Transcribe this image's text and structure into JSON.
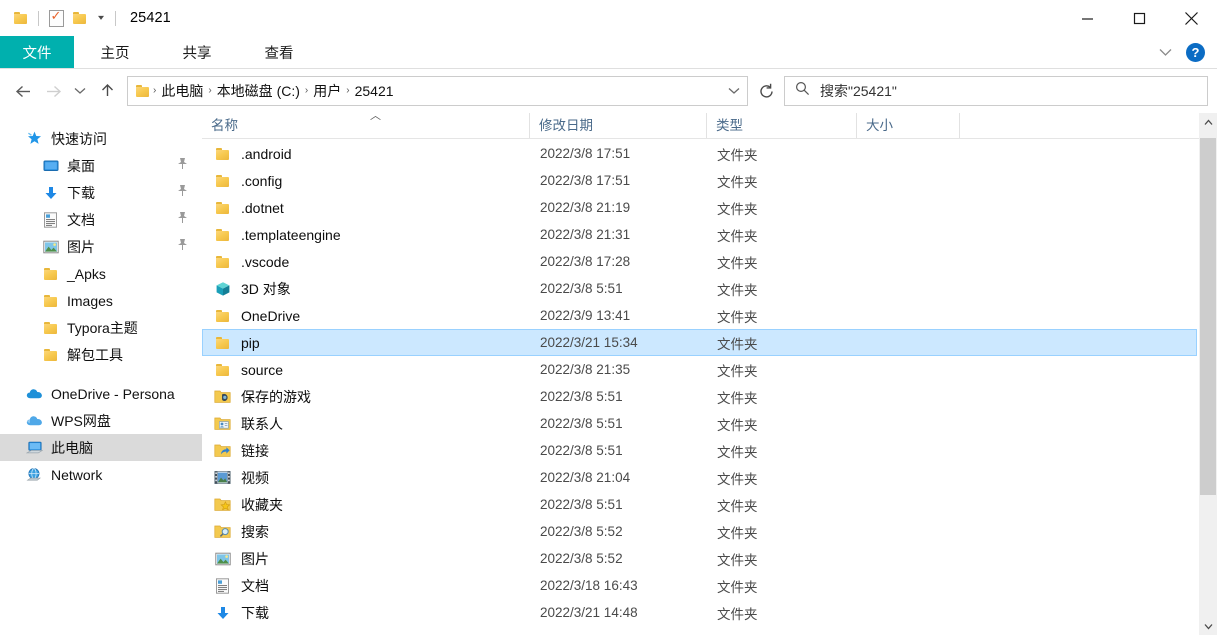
{
  "titlebar": {
    "title": "25421",
    "quick_access": [
      {
        "name": "folder-icon",
        "label": "文件夹"
      },
      {
        "name": "properties-icon",
        "label": "属性"
      },
      {
        "name": "new-folder-icon",
        "label": "新建文件夹"
      },
      {
        "name": "customize-qat-caret",
        "label": "自定义快速访问工具栏"
      }
    ],
    "minimize_label": "最小化",
    "maximize_label": "最大化",
    "close_label": "关闭"
  },
  "ribbon": {
    "tabs": [
      {
        "label": "文件",
        "active": true
      },
      {
        "label": "主页",
        "active": false
      },
      {
        "label": "共享",
        "active": false
      },
      {
        "label": "查看",
        "active": false
      }
    ],
    "collapse_label": "折叠功能区",
    "help_label": "?",
    "accent_color": "#00b0ae"
  },
  "navigation": {
    "back_label": "后退",
    "forward_label": "前进",
    "recent_label": "最近使用的位置",
    "up_label": "上移到",
    "refresh_label": "刷新",
    "breadcrumbs": [
      "此电脑",
      "本地磁盘 (C:)",
      "用户",
      "25421"
    ],
    "crumb_separator": "›",
    "address_caret_label": "历史记录"
  },
  "search": {
    "placeholder": "搜索\"25421\"",
    "icon": "search-icon"
  },
  "sidebar": {
    "groups": [
      {
        "header": {
          "label": "快速访问",
          "icon": "star-icon"
        },
        "items": [
          {
            "label": "桌面",
            "icon": "desktop-icon",
            "pinned": true
          },
          {
            "label": "下载",
            "icon": "download-icon",
            "pinned": true
          },
          {
            "label": "文档",
            "icon": "documents-icon",
            "pinned": true
          },
          {
            "label": "图片",
            "icon": "pictures-icon",
            "pinned": true
          },
          {
            "label": "_Apks",
            "icon": "folder-icon",
            "pinned": false
          },
          {
            "label": "Images",
            "icon": "folder-icon",
            "pinned": false
          },
          {
            "label": "Typora主题",
            "icon": "folder-icon",
            "pinned": false
          },
          {
            "label": "解包工具",
            "icon": "folder-icon",
            "pinned": false
          }
        ]
      }
    ],
    "roots": [
      {
        "label": "OneDrive - Persona",
        "icon": "onedrive-icon",
        "selected": false
      },
      {
        "label": "WPS网盘",
        "icon": "wps-cloud-icon",
        "selected": false
      },
      {
        "label": "此电脑",
        "icon": "this-pc-icon",
        "selected": true
      },
      {
        "label": "Network",
        "icon": "network-icon",
        "selected": false
      }
    ]
  },
  "filelist": {
    "columns": [
      {
        "label": "名称",
        "key": "name"
      },
      {
        "label": "修改日期",
        "key": "date"
      },
      {
        "label": "类型",
        "key": "type"
      },
      {
        "label": "大小",
        "key": "size"
      }
    ],
    "sort_indicator": "︿",
    "rows": [
      {
        "name": ".android",
        "date": "2022/3/8 17:51",
        "type": "文件夹",
        "size": "",
        "icon": "folder-icon",
        "selected": false
      },
      {
        "name": ".config",
        "date": "2022/3/8 17:51",
        "type": "文件夹",
        "size": "",
        "icon": "folder-icon",
        "selected": false
      },
      {
        "name": ".dotnet",
        "date": "2022/3/8 21:19",
        "type": "文件夹",
        "size": "",
        "icon": "folder-icon",
        "selected": false
      },
      {
        "name": ".templateengine",
        "date": "2022/3/8 21:31",
        "type": "文件夹",
        "size": "",
        "icon": "folder-icon",
        "selected": false
      },
      {
        "name": ".vscode",
        "date": "2022/3/8 17:28",
        "type": "文件夹",
        "size": "",
        "icon": "folder-icon",
        "selected": false
      },
      {
        "name": "3D 对象",
        "date": "2022/3/8 5:51",
        "type": "文件夹",
        "size": "",
        "icon": "3d-objects-icon",
        "selected": false
      },
      {
        "name": "OneDrive",
        "date": "2022/3/9 13:41",
        "type": "文件夹",
        "size": "",
        "icon": "folder-icon",
        "selected": false
      },
      {
        "name": "pip",
        "date": "2022/3/21 15:34",
        "type": "文件夹",
        "size": "",
        "icon": "folder-icon",
        "selected": true
      },
      {
        "name": "source",
        "date": "2022/3/8 21:35",
        "type": "文件夹",
        "size": "",
        "icon": "folder-icon",
        "selected": false
      },
      {
        "name": "保存的游戏",
        "date": "2022/3/8 5:51",
        "type": "文件夹",
        "size": "",
        "icon": "saved-games-icon",
        "selected": false
      },
      {
        "name": "联系人",
        "date": "2022/3/8 5:51",
        "type": "文件夹",
        "size": "",
        "icon": "contacts-icon",
        "selected": false
      },
      {
        "name": "链接",
        "date": "2022/3/8 5:51",
        "type": "文件夹",
        "size": "",
        "icon": "links-icon",
        "selected": false
      },
      {
        "name": "视频",
        "date": "2022/3/8 21:04",
        "type": "文件夹",
        "size": "",
        "icon": "videos-icon",
        "selected": false
      },
      {
        "name": "收藏夹",
        "date": "2022/3/8 5:51",
        "type": "文件夹",
        "size": "",
        "icon": "favorites-icon",
        "selected": false
      },
      {
        "name": "搜索",
        "date": "2022/3/8 5:52",
        "type": "文件夹",
        "size": "",
        "icon": "searches-icon",
        "selected": false
      },
      {
        "name": "图片",
        "date": "2022/3/8 5:52",
        "type": "文件夹",
        "size": "",
        "icon": "pictures-icon",
        "selected": false
      },
      {
        "name": "文档",
        "date": "2022/3/18 16:43",
        "type": "文件夹",
        "size": "",
        "icon": "documents-icon",
        "selected": false
      },
      {
        "name": "下载",
        "date": "2022/3/21 14:48",
        "type": "文件夹",
        "size": "",
        "icon": "download-icon",
        "selected": false
      }
    ]
  },
  "scrollbar": {
    "up_label": "向上滚动",
    "down_label": "向下滚动"
  }
}
